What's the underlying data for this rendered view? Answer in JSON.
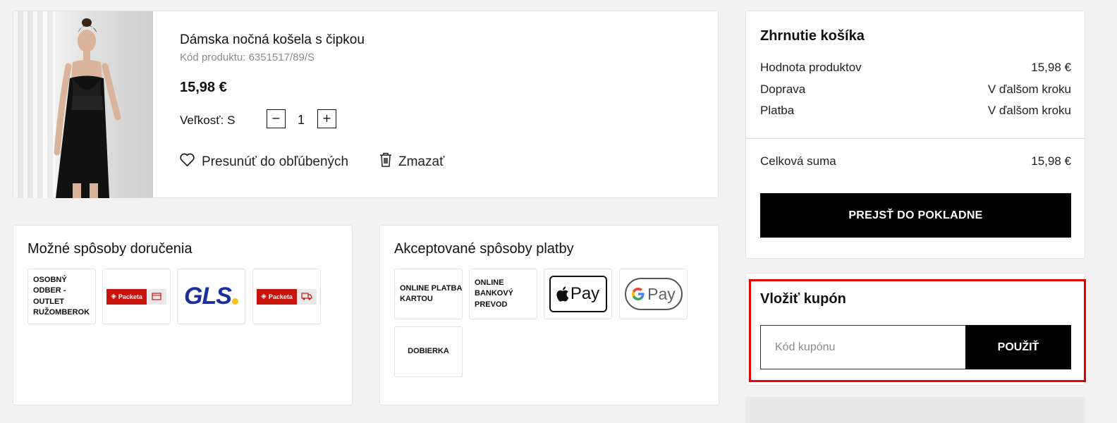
{
  "product": {
    "title": "Dámska nočná košela s čipkou",
    "code": "Kód produktu: 6351517/89/S",
    "price": "15,98 €",
    "size_label": "Veľkosť: S",
    "quantity": "1",
    "qty_minus": "−",
    "qty_plus": "+",
    "move_to_favorites": "Presunúť do obľúbených",
    "delete": "Zmazať"
  },
  "delivery": {
    "title": "Možné spôsoby doručenia",
    "methods": [
      {
        "label": "OSOBNÝ ODBER - OUTLET RUŽOMBEROK"
      },
      {
        "label": "Packeta",
        "icon": "packeta-pickup-icon"
      },
      {
        "label": "GLS",
        "icon": "gls-logo"
      },
      {
        "label": "Packeta",
        "icon": "packeta-courier-icon"
      }
    ]
  },
  "payment": {
    "title": "Akceptované spôsoby platby",
    "methods": [
      {
        "label": "ONLINE PLATBA KARTOU"
      },
      {
        "label": "ONLINE BANKOVÝ PREVOD"
      },
      {
        "label": "Pay",
        "icon": "apple-pay-logo"
      },
      {
        "label": "Pay",
        "icon": "google-pay-logo"
      },
      {
        "label": "DOBIERKA"
      }
    ]
  },
  "summary": {
    "title": "Zhrnutie košíka",
    "rows": [
      {
        "label": "Hodnota produktov",
        "value": "15,98 €"
      },
      {
        "label": "Doprava",
        "value": "V ďalšom kroku"
      },
      {
        "label": "Platba",
        "value": "V ďalšom kroku"
      }
    ],
    "total_label": "Celková suma",
    "total_value": "15,98 €",
    "checkout_label": "PREJSŤ DO POKLADNE"
  },
  "coupon": {
    "title": "Vložiť kupón",
    "placeholder": "Kód kupónu",
    "apply_label": "POUŽIŤ"
  },
  "colors": {
    "highlight": "#e30000",
    "packeta_red": "#c8130c",
    "gls_blue": "#1a2f9e",
    "gls_yellow": "#f6c10a"
  }
}
